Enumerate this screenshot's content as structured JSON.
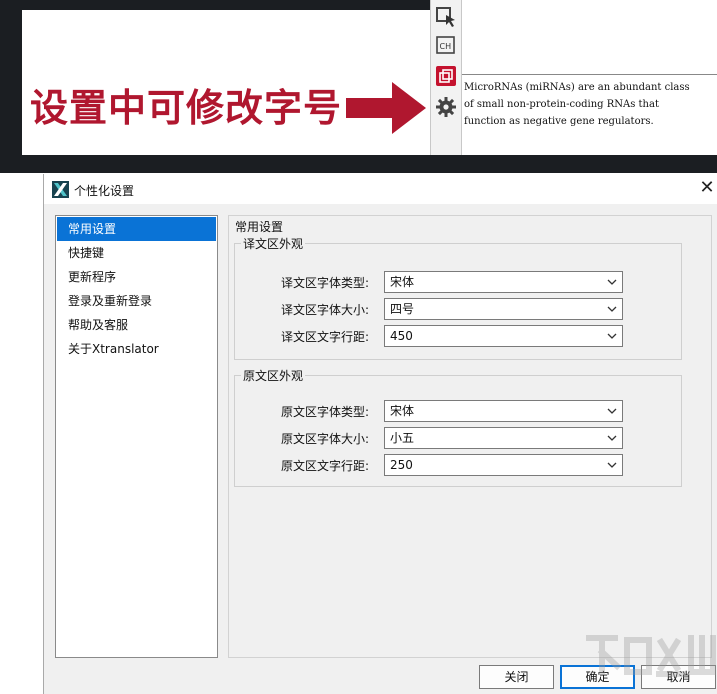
{
  "promo": {
    "caption": "设置中可修改字号",
    "preview_lines": [
      "MicroRNAs (miRNAs) are an abundant class",
      "of small non-protein-coding RNAs that",
      "function as negative gene regulators."
    ],
    "toolbar_icons": [
      "cursor-select-icon",
      "translate-icon",
      "copy-icon",
      "gear-icon"
    ],
    "caption_color": "#b0172f"
  },
  "dialog": {
    "title": "个性化设置",
    "nav": [
      {
        "label": "常用设置",
        "active": true
      },
      {
        "label": "快捷键",
        "active": false
      },
      {
        "label": "更新程序",
        "active": false
      },
      {
        "label": "登录及重新登录",
        "active": false
      },
      {
        "label": "帮助及客服",
        "active": false
      },
      {
        "label": "关于Xtranslator",
        "active": false
      }
    ],
    "section_heading": "常用设置",
    "groups": [
      {
        "title": "译文区外观",
        "rows": [
          {
            "label": "译文区字体类型:",
            "value": "宋体"
          },
          {
            "label": "译文区字体大小:",
            "value": "四号"
          },
          {
            "label": "译文区文字行距:",
            "value": "450"
          }
        ]
      },
      {
        "title": "原文区外观",
        "rows": [
          {
            "label": "原文区字体类型:",
            "value": "宋体"
          },
          {
            "label": "原文区字体大小:",
            "value": "小五"
          },
          {
            "label": "原文区文字行距:",
            "value": "250"
          }
        ]
      }
    ],
    "buttons": {
      "close": "关闭",
      "ok": "确定",
      "cancel": "取消"
    },
    "accent_color": "#0a73d6"
  }
}
